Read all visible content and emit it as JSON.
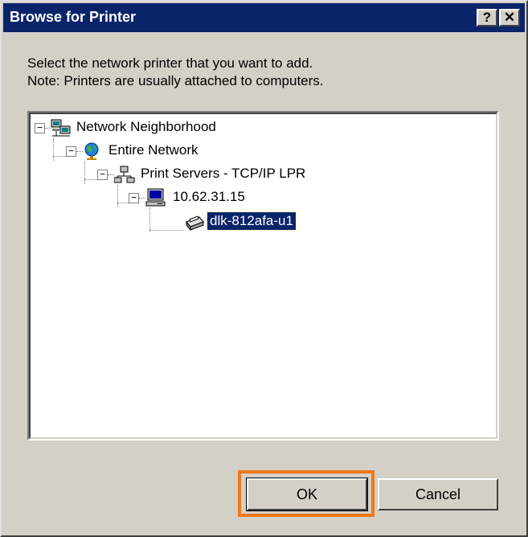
{
  "window": {
    "title": "Browse for Printer",
    "help_glyph": "?",
    "close_glyph": "✕"
  },
  "description": {
    "line1": "Select the network printer that you want to add.",
    "line2": "Note: Printers are usually attached to computers."
  },
  "tree": {
    "nodes": [
      {
        "label": "Network Neighborhood",
        "icon": "network-neighborhood-icon",
        "expanded": true
      },
      {
        "label": "Entire Network",
        "icon": "globe-icon",
        "expanded": true
      },
      {
        "label": "Print Servers - TCP/IP LPR",
        "icon": "print-server-icon",
        "expanded": true
      },
      {
        "label": "10.62.31.15",
        "icon": "computer-icon",
        "expanded": true
      },
      {
        "label": "dlk-812afa-u1",
        "icon": "printer-icon",
        "selected": true
      }
    ],
    "expander_glyph": "−"
  },
  "buttons": {
    "ok": "OK",
    "cancel": "Cancel"
  },
  "colors": {
    "title_bar": "#0a246a",
    "dialog_face": "#d4d0c8",
    "selection": "#0a246a",
    "highlight_box": "#f07818"
  }
}
